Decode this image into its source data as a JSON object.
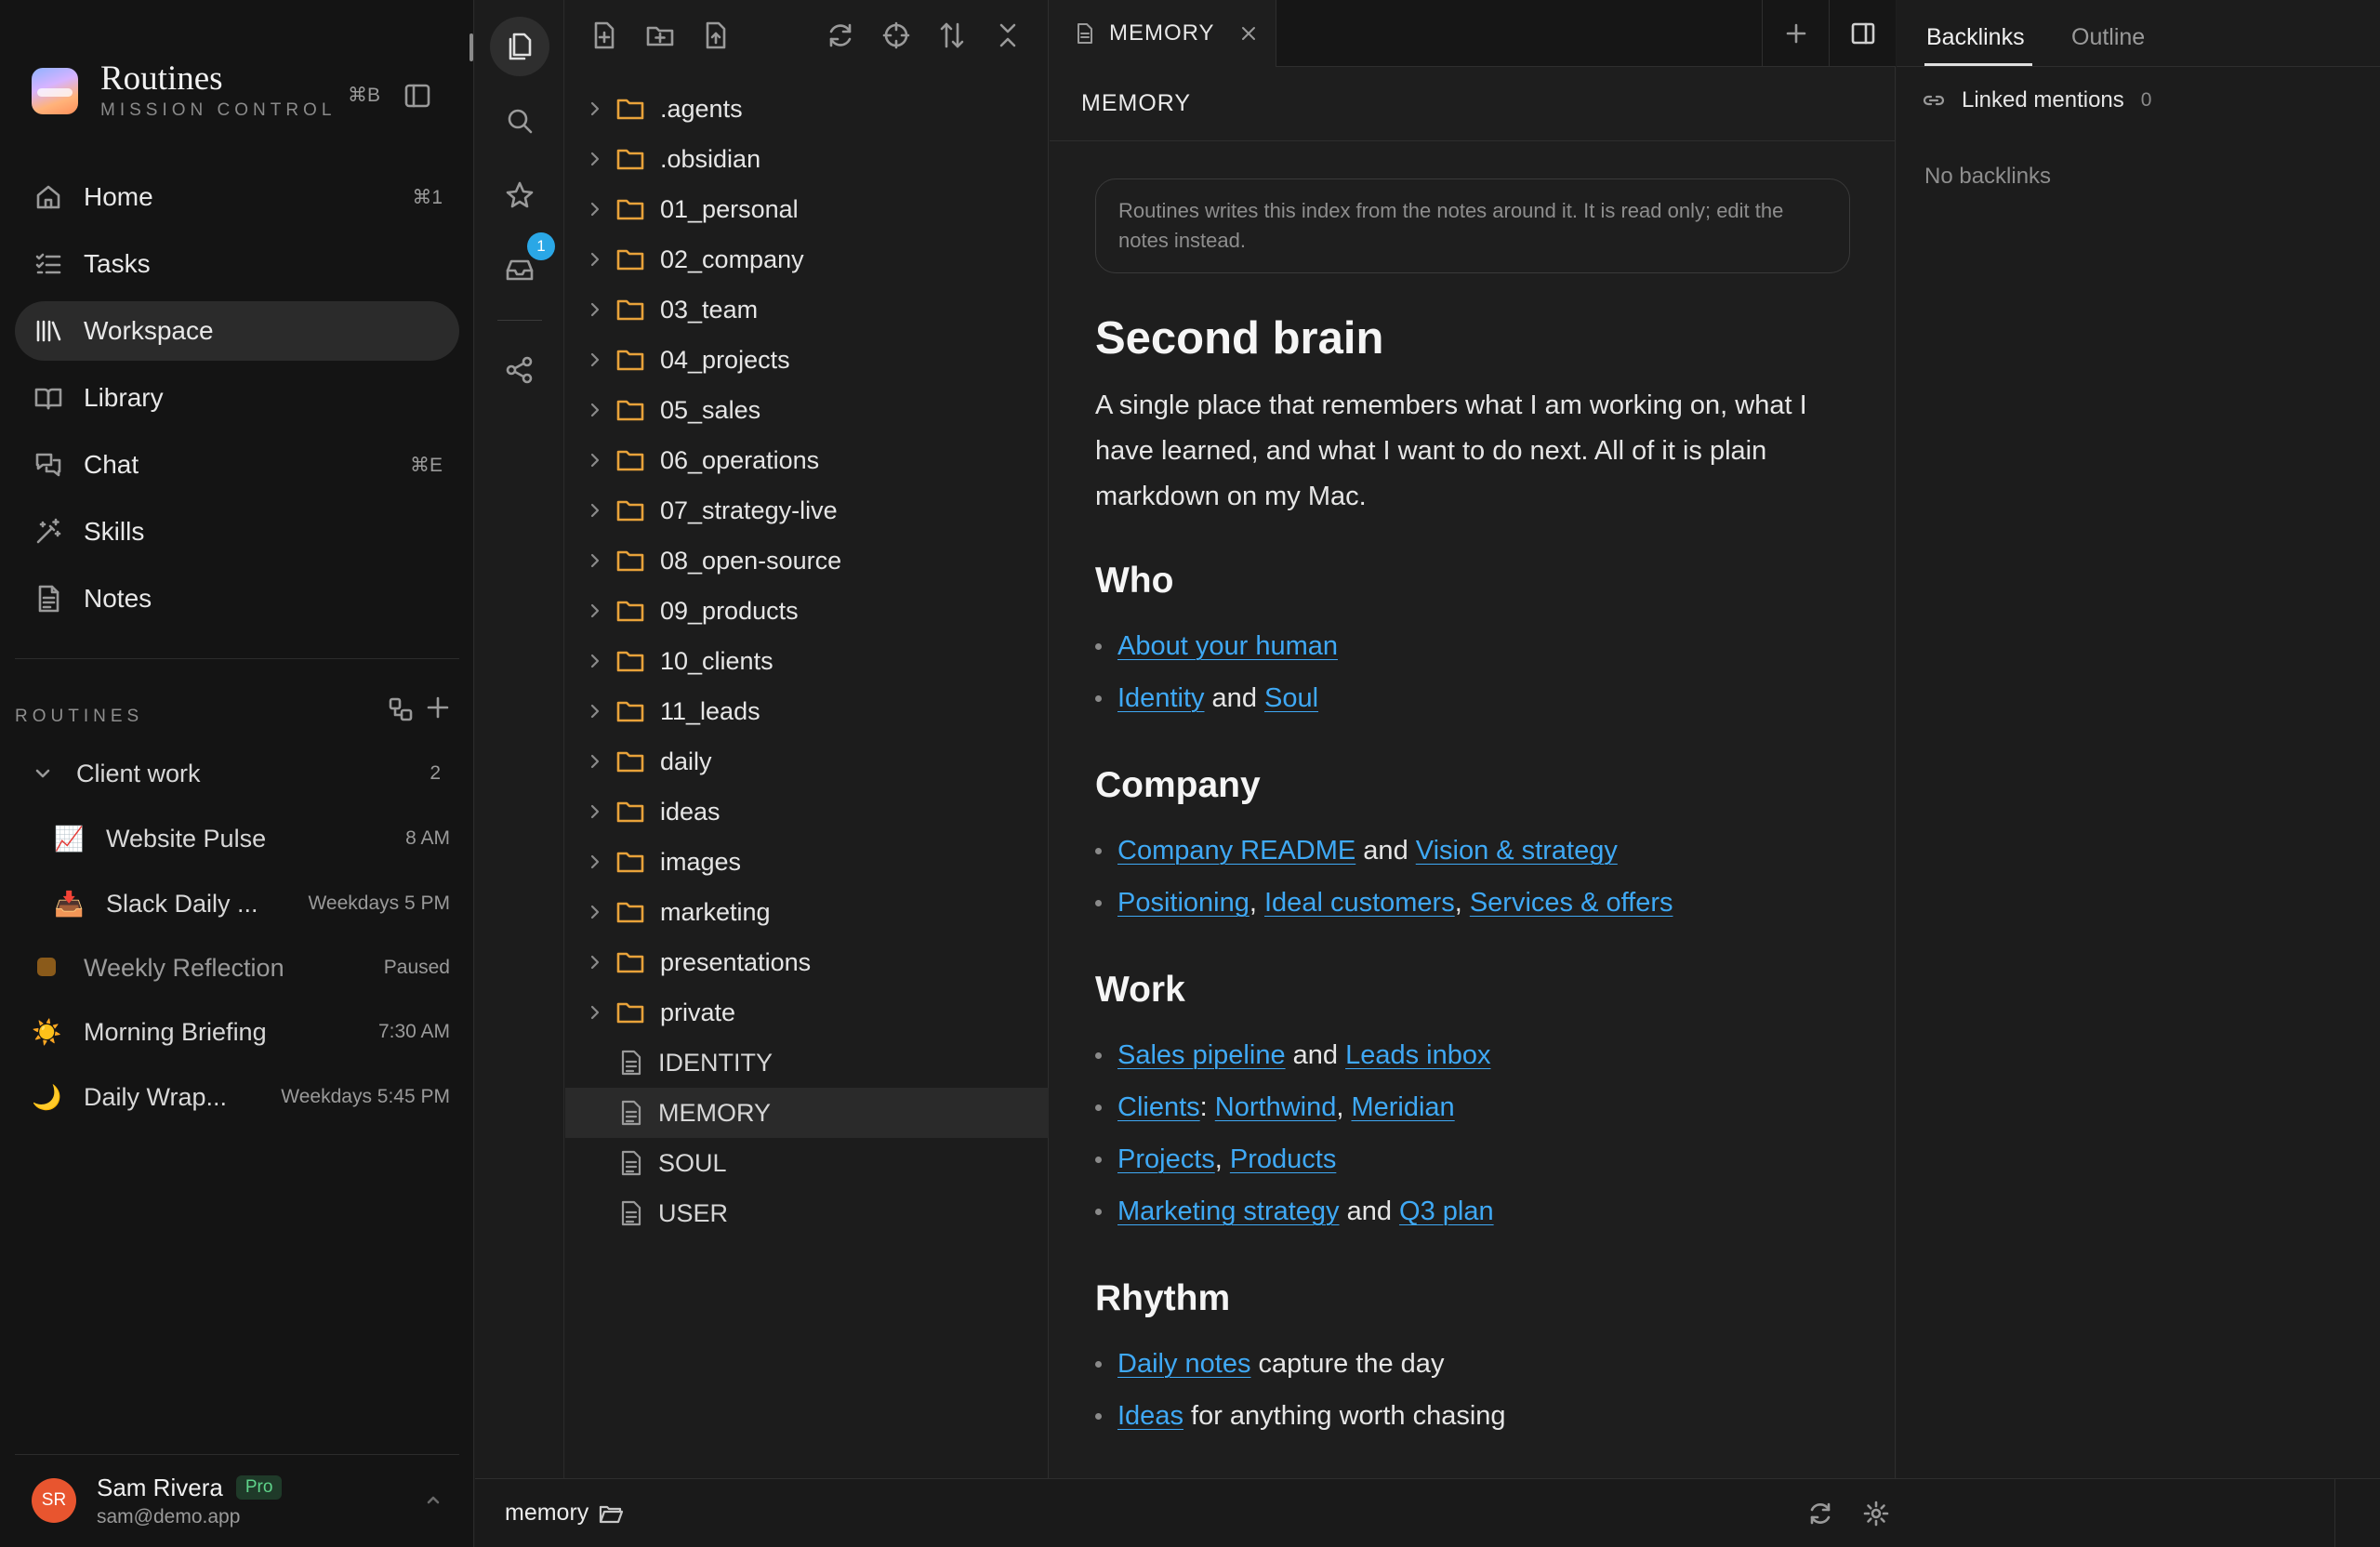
{
  "app": {
    "name": "Routines",
    "subtitle": "MISSION CONTROL",
    "toggle_shortcut": "⌘B"
  },
  "nav": [
    {
      "label": "Home",
      "shortcut": "⌘1",
      "icon": "home-icon"
    },
    {
      "label": "Tasks",
      "shortcut": "",
      "icon": "checklist-icon"
    },
    {
      "label": "Workspace",
      "shortcut": "",
      "icon": "library-books-icon",
      "active": true
    },
    {
      "label": "Library",
      "shortcut": "",
      "icon": "book-open-icon"
    },
    {
      "label": "Chat",
      "shortcut": "⌘E",
      "icon": "chat-bubbles-icon"
    },
    {
      "label": "Skills",
      "shortcut": "",
      "icon": "magic-wand-icon"
    },
    {
      "label": "Notes",
      "shortcut": "",
      "icon": "note-icon"
    }
  ],
  "routines": {
    "heading": "ROUTINES",
    "group": {
      "label": "Client work",
      "count": "2"
    },
    "items": [
      {
        "emoji": "📈",
        "label": "Website Pulse",
        "meta": "8 AM",
        "nested": true
      },
      {
        "emoji": "📥",
        "label": "Slack Daily ...",
        "meta": "Weekdays 5 PM",
        "nested": true
      },
      {
        "emoji": "🟫",
        "label": "Weekly Reflection",
        "meta": "Paused",
        "paused": true
      },
      {
        "emoji": "☀️",
        "label": "Morning Briefing",
        "meta": "7:30 AM"
      },
      {
        "emoji": "🌙",
        "label": "Daily Wrap...",
        "meta": "Weekdays 5:45 PM"
      }
    ]
  },
  "user": {
    "initials": "SR",
    "name": "Sam Rivera",
    "plan": "Pro",
    "email": "sam@demo.app"
  },
  "ribbon": {
    "badge_count": "1"
  },
  "explorer": {
    "folders": [
      ".agents",
      ".obsidian",
      "01_personal",
      "02_company",
      "03_team",
      "04_projects",
      "05_sales",
      "06_operations",
      "07_strategy-live",
      "08_open-source",
      "09_products",
      "10_clients",
      "11_leads",
      "daily",
      "ideas",
      "images",
      "marketing",
      "presentations",
      "private"
    ],
    "files": [
      "IDENTITY",
      "MEMORY",
      "SOUL",
      "USER"
    ],
    "selected_file": "MEMORY"
  },
  "editor": {
    "tab_label": "MEMORY",
    "view_title": "MEMORY",
    "notice": "Routines writes this index from the notes around it. It is read only; edit the notes instead.",
    "h1": "Second brain",
    "intro": "A single place that remembers what I am working on, what I have learned, and what I want to do next. All of it is plain markdown on my Mac.",
    "sections": {
      "who": {
        "title": "Who",
        "l1_link": "About your human",
        "l2_link1": "Identity",
        "l2_and": " and ",
        "l2_link2": "Soul"
      },
      "company": {
        "title": "Company",
        "l1_link1": "Company README",
        "l1_and": " and ",
        "l1_link2": "Vision & strategy",
        "l2_link1": "Positioning",
        "l2_sep1": ", ",
        "l2_link2": "Ideal customers",
        "l2_sep2": ", ",
        "l2_link3": "Services & offers"
      },
      "work": {
        "title": "Work",
        "l1_link1": "Sales pipeline",
        "l1_and": " and ",
        "l1_link2": "Leads inbox",
        "l2_link1": "Clients",
        "l2_sep1": ": ",
        "l2_link2": "Northwind",
        "l2_sep2": ", ",
        "l2_link3": "Meridian",
        "l3_link1": "Projects",
        "l3_sep": ", ",
        "l3_link2": "Products",
        "l4_link1": "Marketing strategy",
        "l4_and": " and ",
        "l4_link2": "Q3 plan"
      },
      "rhythm": {
        "title": "Rhythm",
        "l1_link": "Daily notes",
        "l1_text": " capture the day",
        "l2_link": "Ideas",
        "l2_text": " for anything worth chasing"
      }
    }
  },
  "right_panel": {
    "tabs": [
      "Backlinks",
      "Outline"
    ],
    "linked_mentions_label": "Linked mentions",
    "linked_mentions_count": "0",
    "empty_text": "No backlinks"
  },
  "statusbar": {
    "path": "memory"
  },
  "colors": {
    "link": "#3fa9f5",
    "folder": "#e8a23a",
    "badge": "#2aa7e6",
    "avatar": "#e8552f",
    "pro_badge": "#5fd38a"
  }
}
